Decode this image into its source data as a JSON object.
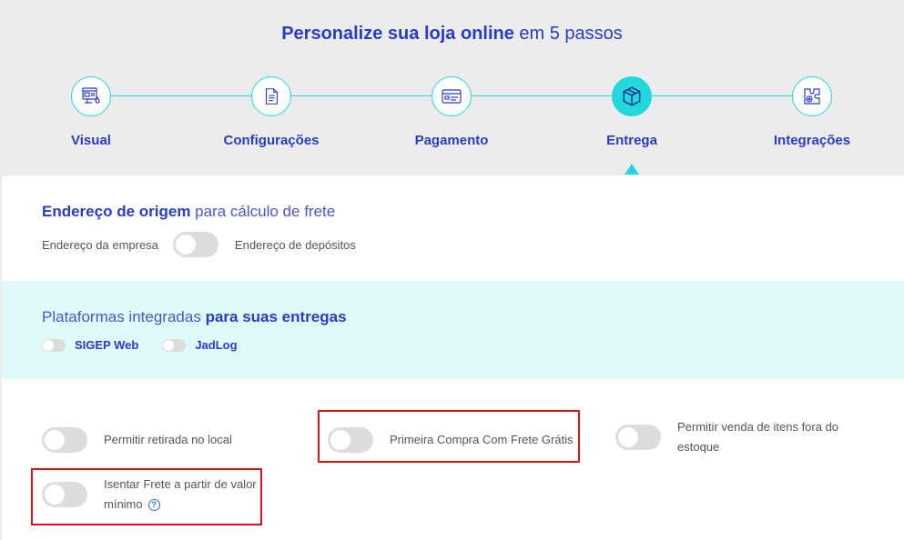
{
  "header": {
    "title_bold": "Personalize sua loja online",
    "title_light": "em 5 passos"
  },
  "steps": [
    {
      "label": "Visual",
      "icon": "visual-icon",
      "active": false
    },
    {
      "label": "Configurações",
      "icon": "document-icon",
      "active": false
    },
    {
      "label": "Pagamento",
      "icon": "payment-icon",
      "active": false
    },
    {
      "label": "Entrega",
      "icon": "box-icon",
      "active": true
    },
    {
      "label": "Integrações",
      "icon": "integration-icon",
      "active": false
    }
  ],
  "origin": {
    "title_bold": "Endereço de origem",
    "title_light": "para cálculo de frete",
    "left_label": "Endereço da empresa",
    "right_label": "Endereço de depósitos"
  },
  "platforms": {
    "title_light": "Plataformas integradas",
    "title_bold": "para suas entregas",
    "items": [
      "SIGEP Web",
      "JadLog"
    ]
  },
  "options": {
    "pickup": "Permitir retirada no local",
    "first_free": "Primeira Compra Com Frete Grátis",
    "out_of_stock": "Permitir venda de itens fora do estoque",
    "exempt_min": "Isentar Frete a partir de valor mínimo",
    "help_glyph": "?"
  },
  "colors": {
    "accent": "#23d8dd",
    "brand": "#2a3cc4",
    "highlight": "#e0101a"
  }
}
